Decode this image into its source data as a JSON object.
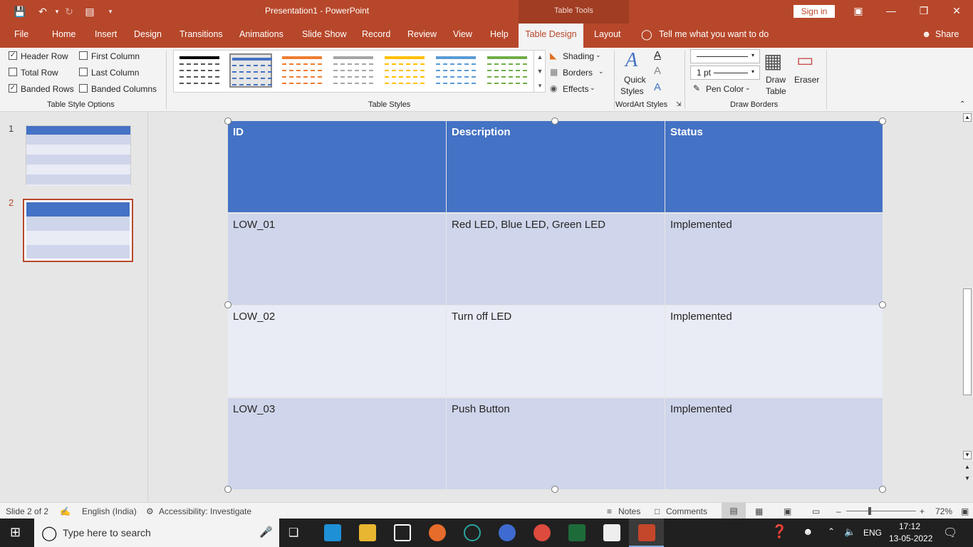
{
  "window": {
    "title": "Presentation1  -  PowerPoint",
    "context_tab_group": "Table Tools",
    "sign_in": "Sign in"
  },
  "tabs": [
    "File",
    "Home",
    "Insert",
    "Design",
    "Transitions",
    "Animations",
    "Slide Show",
    "Record",
    "Review",
    "View",
    "Help",
    "Table Design",
    "Layout"
  ],
  "active_tab": "Table Design",
  "tell_me": "Tell me what you want to do",
  "share": "Share",
  "ribbon": {
    "style_options": {
      "header_row": "Header Row",
      "total_row": "Total Row",
      "banded_rows": "Banded Rows",
      "first_column": "First Column",
      "last_column": "Last Column",
      "banded_columns": "Banded Columns",
      "group_label": "Table Style Options"
    },
    "table_styles_label": "Table Styles",
    "shading": "Shading",
    "borders": "Borders",
    "effects": "Effects",
    "quick_styles_1": "Quick",
    "quick_styles_2": "Styles",
    "wordart_label": "WordArt Styles",
    "pen_weight": "1 pt",
    "pen_color": "Pen Color",
    "draw_table_1": "Draw",
    "draw_table_2": "Table",
    "eraser": "Eraser",
    "draw_borders_label": "Draw Borders",
    "style_colors": [
      "#000000",
      "#4472c4",
      "#ed7d31",
      "#a5a5a5",
      "#ffc000",
      "#5b9bd5",
      "#70ad47"
    ]
  },
  "slides_panel": {
    "numbers": [
      "1",
      "2"
    ]
  },
  "table": {
    "headers": [
      "ID",
      "Description",
      "Status"
    ],
    "rows": [
      [
        "LOW_01",
        "Red LED, Blue LED, Green LED",
        "Implemented"
      ],
      [
        "LOW_02",
        "Turn off LED",
        "Implemented"
      ],
      [
        "LOW_03",
        "Push Button",
        "Implemented"
      ]
    ]
  },
  "status": {
    "slide": "Slide 2 of 2",
    "language": "English (India)",
    "accessibility": "Accessibility: Investigate",
    "notes": "Notes",
    "comments": "Comments",
    "zoom": "72%"
  },
  "taskbar": {
    "search_placeholder": "Type here to search",
    "lang": "ENG",
    "time": "17:12",
    "date": "13-05-2022"
  }
}
